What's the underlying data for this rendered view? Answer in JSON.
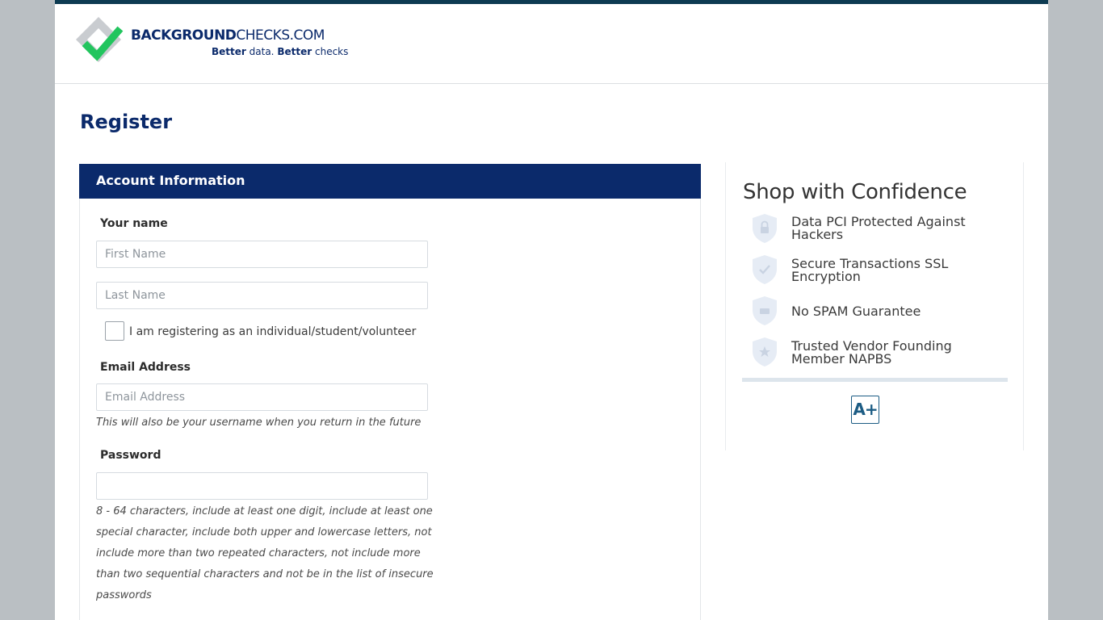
{
  "header": {
    "logo": {
      "brand_bold": "BACKGROUND",
      "brand_light": "CHECKS.COM",
      "tagline_bold_1": "Better",
      "tagline_light_1": "data.",
      "tagline_bold_2": "Better",
      "tagline_light_2": "checks"
    }
  },
  "page": {
    "title": "Register"
  },
  "form": {
    "section_title": "Account Information",
    "name_label": "Your name",
    "first_name_placeholder": "First Name",
    "last_name_placeholder": "Last Name",
    "individual_checkbox_label": "I am registering as an individual/student/volunteer",
    "individual_checkbox_checked": false,
    "email_label": "Email Address",
    "email_placeholder": "Email Address",
    "email_hint": "This will also be your username when you return in the future",
    "password_label": "Password",
    "password_value": "",
    "password_hint": "8 - 64 characters, include at least one digit, include at least one special character, include both upper and lowercase letters, not include more than two repeated characters, not include more than two sequential characters and not be in the list of insecure passwords"
  },
  "sidebar": {
    "title": "Shop with Confidence",
    "items": [
      {
        "icon": "lock-shield-icon",
        "label": "Data PCI Protected Against Hackers"
      },
      {
        "icon": "check-shield-icon",
        "label": "Secure Transactions SSL Encryption"
      },
      {
        "icon": "mail-shield-icon",
        "label": "No SPAM Guarantee"
      },
      {
        "icon": "star-shield-icon",
        "label": "Trusted Vendor Founding Member NAPBS"
      }
    ],
    "rating_badge": "A+"
  },
  "colors": {
    "brand_navy": "#0b2a6b",
    "brand_green": "#22c55e",
    "top_strip": "#0d3b52",
    "background": "#babfc3",
    "shield_fill": "#e6ecf5"
  }
}
